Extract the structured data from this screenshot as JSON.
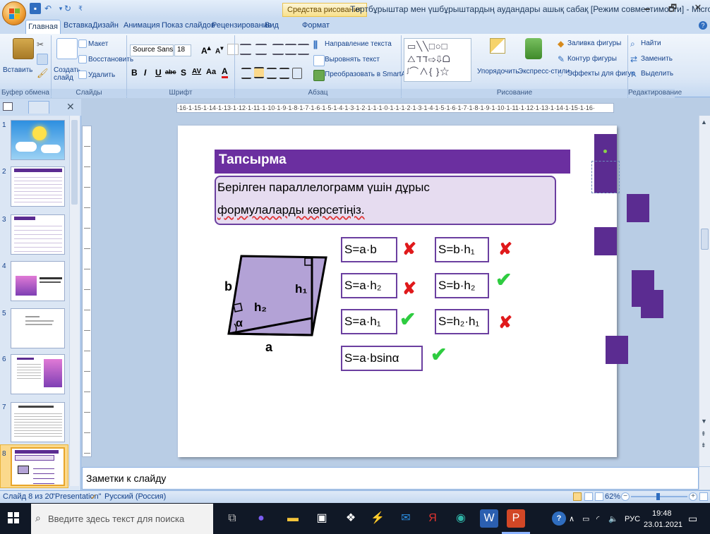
{
  "window": {
    "title": "Төртбұрыштар мен үшбұрыштардың аудандары ашық сабақ [Режим совместимости] - Microsoft",
    "context_tab": "Средства рисования",
    "controls": [
      "🗕",
      "🗗",
      "✕"
    ]
  },
  "tabs": [
    "Главная",
    "Вставка",
    "Дизайн",
    "Анимация",
    "Показ слайдов",
    "Рецензирование",
    "Вид",
    "Формат"
  ],
  "ribbon": {
    "clipboard": {
      "paste": "Вставить",
      "group": "Буфер обмена"
    },
    "slides": {
      "create": "Создать слайд",
      "layout": "Макет",
      "reset": "Восстановить",
      "delete": "Удалить",
      "group": "Слайды"
    },
    "font": {
      "name": "Source Sans Pro",
      "size": "18",
      "group": "Шрифт",
      "bold": "B",
      "italic": "I",
      "underline": "U",
      "strike": "abc",
      "shadow": "S",
      "spacing": "AV",
      "case": "Aa",
      "color": "A"
    },
    "paragraph": {
      "direction": "Направление текста",
      "align": "Выровнять текст",
      "smartart": "Преобразовать в SmartArt",
      "group": "Абзац"
    },
    "drawing": {
      "arrange": "Упорядочить",
      "quick_styles": "Экспресс-стили",
      "fill": "Заливка фигуры",
      "outline": "Контур фигуры",
      "effects": "Эффекты для фигур",
      "group": "Рисование"
    },
    "editing": {
      "find": "Найти",
      "replace": "Заменить",
      "select": "Выделить",
      "group": "Редактирование"
    }
  },
  "ruler_h": "·16·1·15·1·14·1·13·1·12·1·11·1·10·1·9·1·8·1·7·1·6·1·5·1·4·1·3·1·2·1·1·1·0·1·1·1·2·1·3·1·4·1·5·1·6·1·7·1·8·1·9·1·10·1·11·1·12·1·13·1·14·1·15·1·16·",
  "slides_panel": {
    "numbers": [
      "1",
      "2",
      "3",
      "4",
      "5",
      "6",
      "7",
      "8"
    ],
    "selected": "8"
  },
  "slide": {
    "banner": "Тапсырма",
    "task_line1": "Берілген параллелограмм үшін дұрыс",
    "task_line2": "формулаларды көрсетіңіз.",
    "labels": {
      "b": "b",
      "h1": "h₁",
      "h2": "h₂",
      "alpha": "α",
      "a": "a"
    },
    "formulas": [
      {
        "text": "S=a·b",
        "mark": "✘"
      },
      {
        "text": "S=b·h₁",
        "mark": "✘"
      },
      {
        "text": "S=a·h₂",
        "mark": "✘"
      },
      {
        "text": "S=b·h₂",
        "mark": "✔"
      },
      {
        "text": "S=a·h₁",
        "mark": "✔"
      },
      {
        "text": "S=h₂·h₁",
        "mark": "✘"
      },
      {
        "text": "S=a·bsinα",
        "mark": "✔"
      }
    ]
  },
  "notes": "Заметки к слайду",
  "status": {
    "slide": "Слайд 8 из 20",
    "theme": "\"Presentation\"",
    "lang": "Русский (Россия)",
    "zoom": "62%"
  },
  "taskbar": {
    "search": "Введите здесь текст для поиска",
    "lang": "РУС",
    "time": "19:48",
    "date": "23.01.2021"
  },
  "colors": {
    "accent": "#6b2fa0",
    "ok": "#2ecc40",
    "bad": "#e0191b"
  }
}
